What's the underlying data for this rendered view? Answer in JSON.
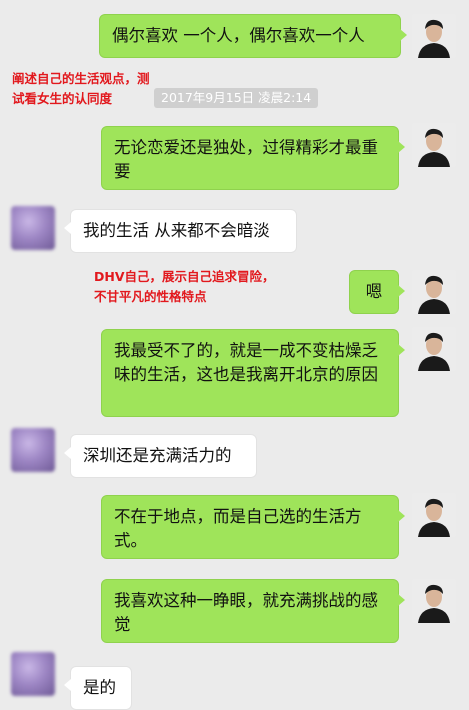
{
  "timestamp": "2017年9月15日 凌晨2:14",
  "annotations": {
    "a1": [
      "阐述自己的生活观点，测",
      "试看女生的认同度"
    ],
    "a2": [
      "DHV自己，展示自己追求冒险，",
      "不甘平凡的性格特点"
    ]
  },
  "messages": [
    {
      "side": "out",
      "text": "偶尔喜欢 一个人，偶尔喜欢一个人"
    },
    {
      "side": "out",
      "text": "无论恋爱还是独处，过得精彩才最重要"
    },
    {
      "side": "in",
      "text": "我的生活 从来都不会暗淡"
    },
    {
      "side": "out",
      "text": "嗯"
    },
    {
      "side": "out",
      "text": "我最受不了的，就是一成不变枯燥乏味的生活，这也是我离开北京的原因"
    },
    {
      "side": "in",
      "text": "深圳还是充满活力的"
    },
    {
      "side": "out",
      "text": "不在于地点，而是自己选的生活方式。"
    },
    {
      "side": "out",
      "text": "我喜欢这种一睁眼，就充满挑战的感觉"
    },
    {
      "side": "in",
      "text": "是的"
    }
  ],
  "icons": {
    "self_avatar": "user-avatar-icon",
    "contact_avatar": "contact-avatar-icon"
  }
}
